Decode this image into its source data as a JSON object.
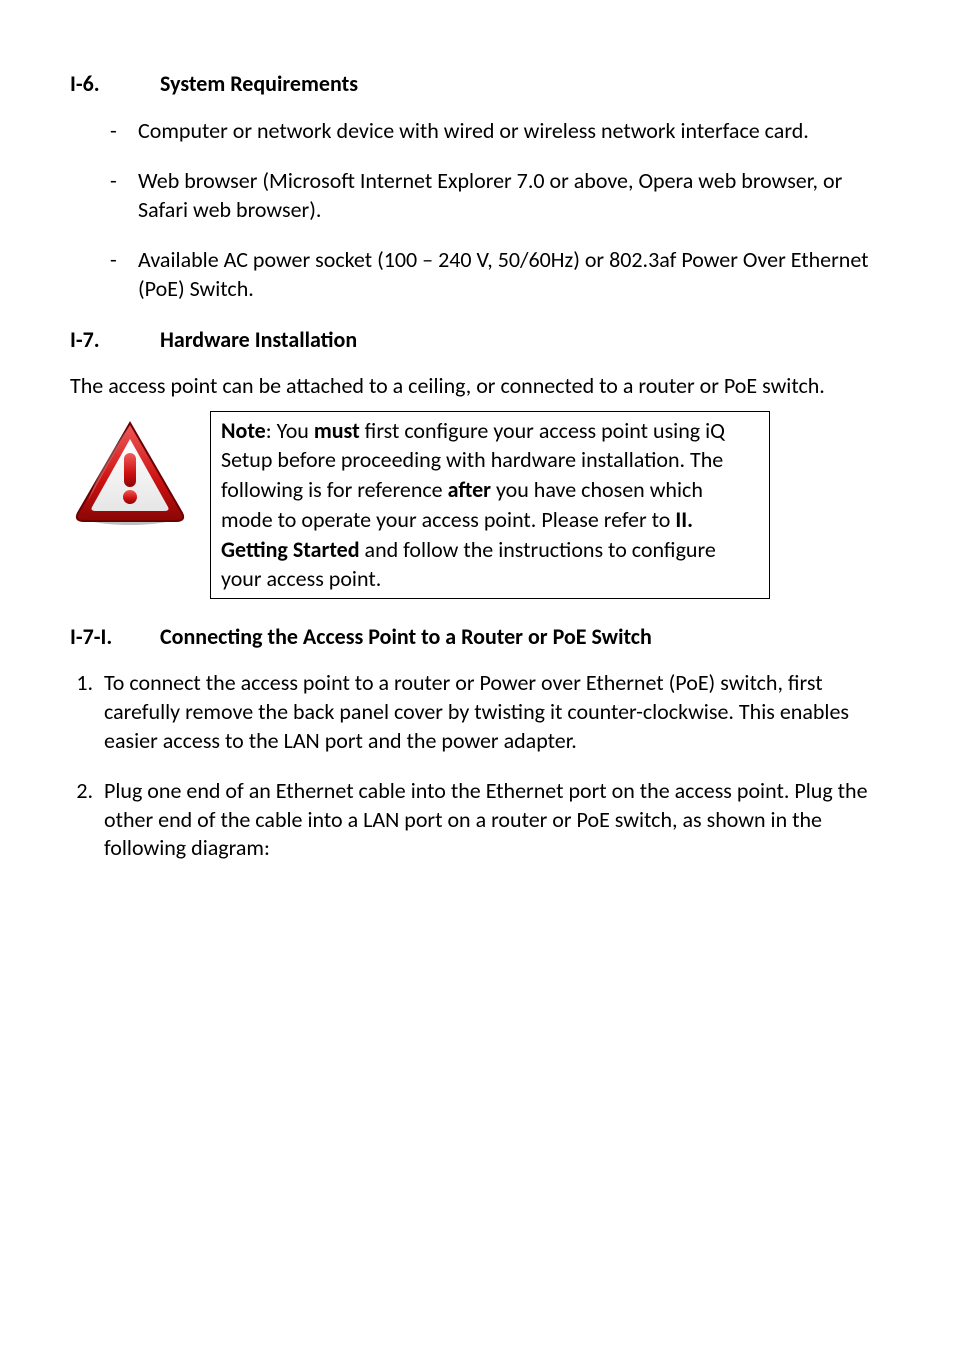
{
  "sec_i6": {
    "num": "I-6.",
    "title": "System Requirements",
    "items": [
      "Computer or network device with wired or wireless network interface card.",
      "Web browser (Microsoft Internet Explorer 7.0 or above, Opera web browser, or Safari web browser).",
      "Available AC power socket (100 – 240 V, 50/60Hz) or 802.3af Power Over Ethernet (PoE) Switch."
    ]
  },
  "sec_i7": {
    "num": "I-7.",
    "title": "Hardware Installation",
    "para": "The access point can be attached to a ceiling, or connected to a router or PoE switch.",
    "note": {
      "label": "Note",
      "t1": ": You ",
      "b1": "must",
      "t2": " first configure your access point using iQ Setup before proceeding with hardware installation. The following is for reference ",
      "b2": "after",
      "t3": " you have chosen which mode to operate your access point. Please refer to ",
      "b3": "II. Getting Started",
      "t4": " and follow the instructions to configure your access point."
    }
  },
  "sec_i7i": {
    "num": "I-7-I.",
    "title": "Connecting the Access Point to a Router or PoE Switch",
    "steps": [
      "To connect the access point to a router or Power over Ethernet (PoE) switch, first carefully remove the back panel cover by twisting it counter-clockwise. This enables easier access to the LAN port and the power adapter.",
      "Plug one end of an Ethernet cable into the Ethernet port on the access point. Plug the other end of the cable into a LAN port on a router or PoE switch, as shown in the following diagram:"
    ]
  }
}
